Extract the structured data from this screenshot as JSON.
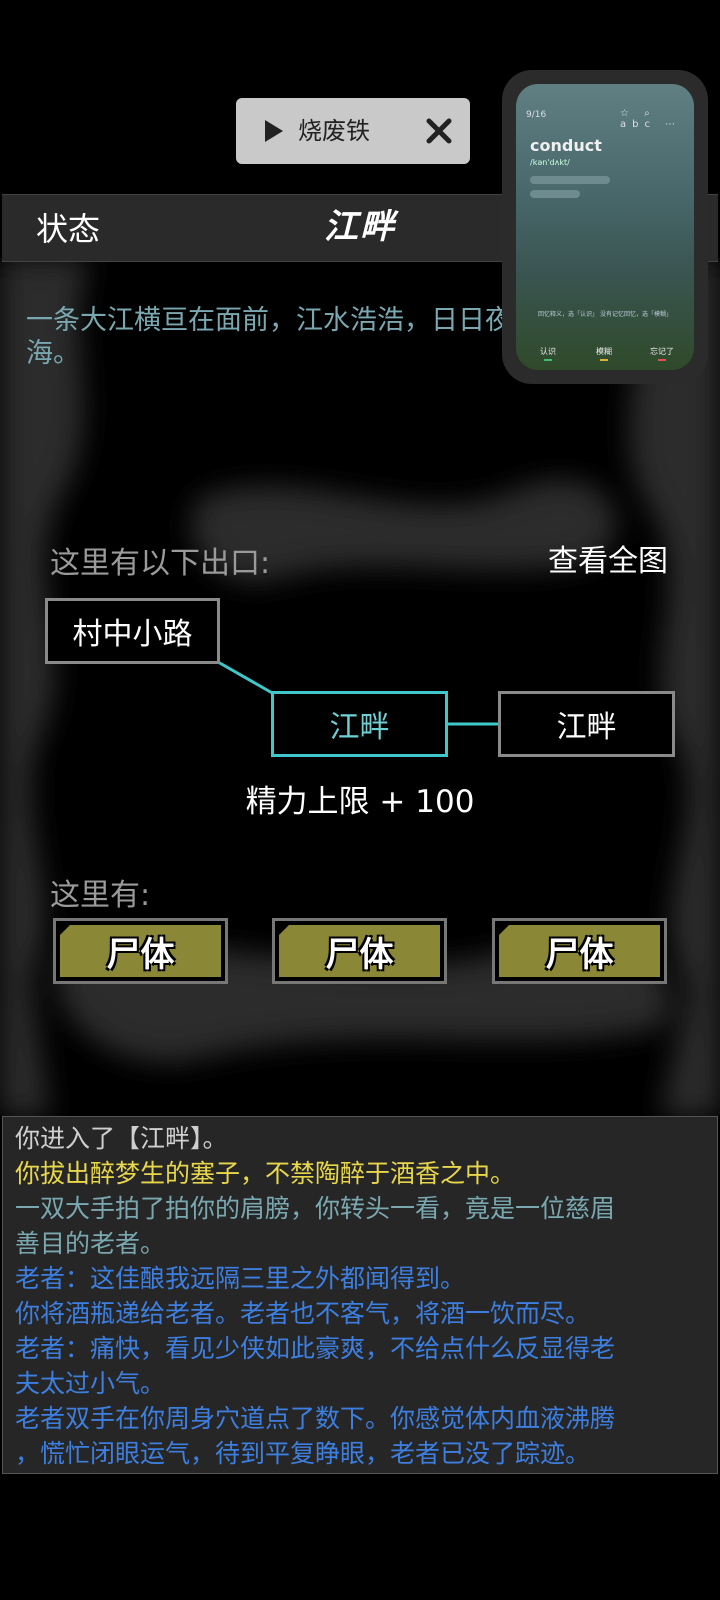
{
  "music": {
    "title": "烧废铁",
    "play_icon": "play-icon",
    "close_icon": "close-icon"
  },
  "header": {
    "status_label": "状态",
    "title": "江畔"
  },
  "description": "一条大江横亘在面前，江水浩浩，日日夜夜地奔向大海。",
  "overlay": {
    "counter": "9/16",
    "icons": "☆ ⌕ abc ⋯",
    "word": "conduct",
    "phonetic": "/kən'dʌkt/",
    "hint": "回忆释义，选「认识」 没有记忆回忆，选「模糊」",
    "buttons": [
      {
        "label": "认识",
        "color": "#3fbf6a"
      },
      {
        "label": "模糊",
        "color": "#e0b030"
      },
      {
        "label": "忘记了",
        "color": "#e05050"
      }
    ]
  },
  "exits": {
    "label": "这里有以下出口:",
    "map_link": "查看全图",
    "nodes": {
      "village_path": "村中小路",
      "current": "江畔",
      "east": "江畔"
    }
  },
  "stamina": "精力上限 + 100",
  "here": {
    "label": "这里有:",
    "entities": [
      "尸体",
      "尸体",
      "尸体"
    ]
  },
  "colors": {
    "accent_cyan": "#3fc7c9",
    "log_yellow": "#e8d74a",
    "log_teal": "#7aa8b0",
    "log_blue": "#3d7fe0",
    "entity_olive": "#8a8736"
  },
  "log": [
    {
      "text": "你进入了【江畔】。",
      "color": "#cfcfcf"
    },
    {
      "text": "你拔出醉梦生的塞子，不禁陶醉于酒香之中。",
      "color": "#e8d74a"
    },
    {
      "text": "一双大手拍了拍你的肩膀，你转头一看，竟是一位慈眉",
      "color": "#7aa8b0"
    },
    {
      "text": "善目的老者。",
      "color": "#7aa8b0"
    },
    {
      "text": "老者：这佳酿我远隔三里之外都闻得到。",
      "color": "#3d7fe0"
    },
    {
      "text": "你将酒瓶递给老者。老者也不客气，将酒一饮而尽。",
      "color": "#3d7fe0"
    },
    {
      "text": "老者：痛快，看见少侠如此豪爽，不给点什么反显得老",
      "color": "#3d7fe0"
    },
    {
      "text": "夫太过小气。",
      "color": "#3d7fe0"
    },
    {
      "text": "老者双手在你周身穴道点了数下。你感觉体内血液沸腾",
      "color": "#3d7fe0"
    },
    {
      "text": "，慌忙闭眼运气，待到平复睁眼，老者已没了踪迹。",
      "color": "#3d7fe0"
    }
  ]
}
